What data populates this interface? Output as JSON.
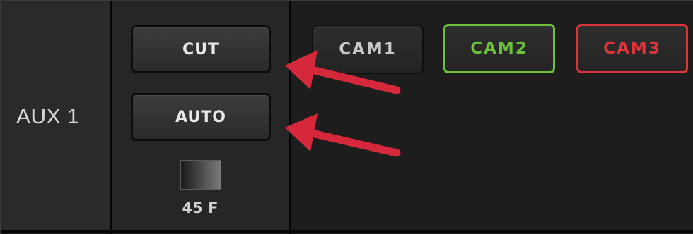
{
  "row": {
    "label": "AUX 1"
  },
  "transition": {
    "cut_label": "CUT",
    "auto_label": "AUTO",
    "rate_text": "45 F"
  },
  "sources": [
    {
      "label": "CAM1",
      "state": "normal"
    },
    {
      "label": "CAM2",
      "state": "preview",
      "color": "#6ec03c"
    },
    {
      "label": "CAM3",
      "state": "program",
      "color": "#e0343a"
    }
  ],
  "annotations": {
    "arrow_color": "#d5283b",
    "arrow_targets": [
      "CUT",
      "AUTO"
    ]
  }
}
